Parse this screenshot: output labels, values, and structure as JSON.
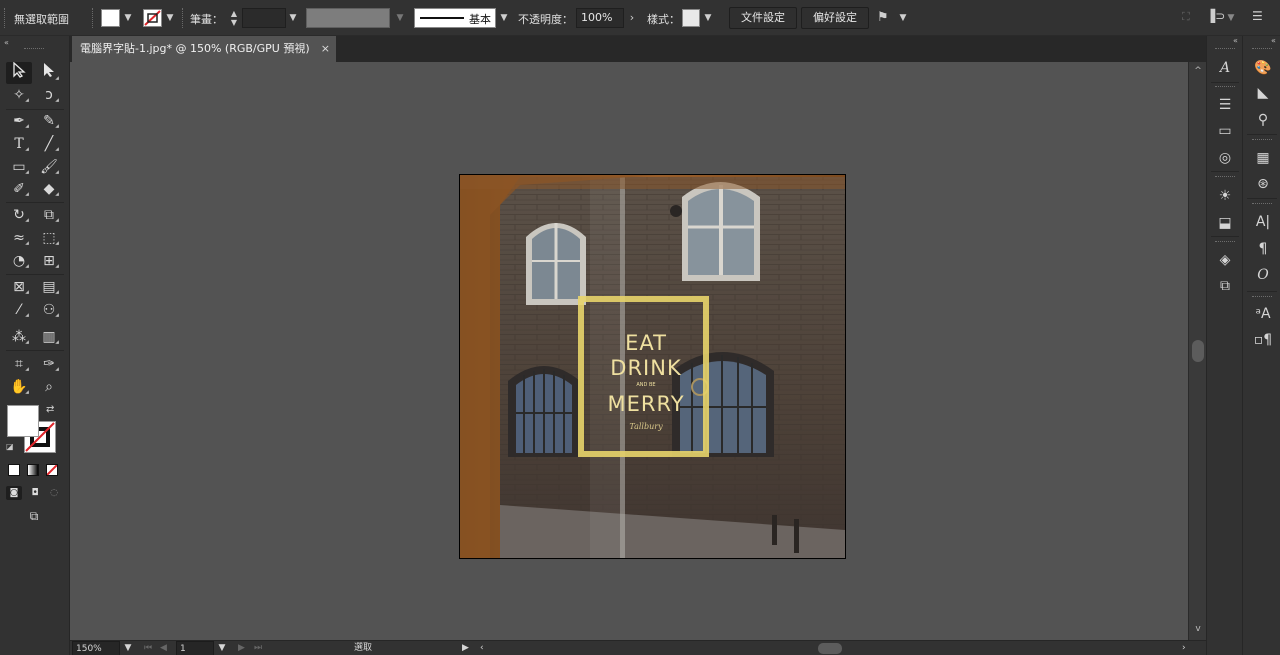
{
  "control_bar": {
    "selection_label": "無選取範圍",
    "stroke_label": "筆畫：",
    "brush_name": "基本",
    "opacity_label": "不透明度：",
    "opacity_value": "100%",
    "style_label": "樣式：",
    "doc_setup_button": "文件設定",
    "preferences_button": "偏好設定"
  },
  "document": {
    "tab_title": "電腦界字貼-1.jpg* @ 150% (RGB/GPU 預視)",
    "close_glyph": "×"
  },
  "artwork": {
    "line1": "EAT",
    "line2": "DRINK",
    "line3": "AND BE",
    "line4": "MERRY",
    "signature": "Tallbury"
  },
  "status_bar": {
    "zoom": "150%",
    "artboard_number": "1",
    "tool_status": "選取"
  },
  "colors": {
    "ui_dark": "#323232",
    "canvas": "#535353",
    "sign_yellow": "#e8d46a"
  }
}
